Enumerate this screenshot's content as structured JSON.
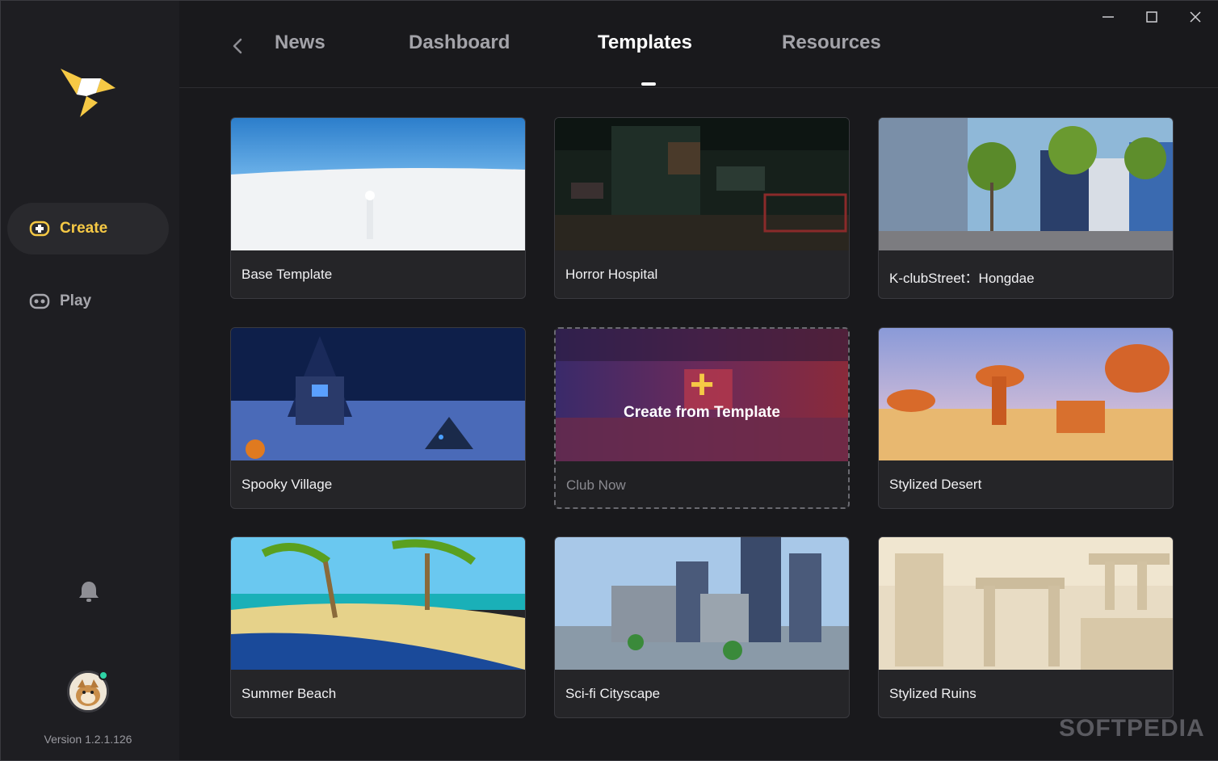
{
  "sidebar": {
    "nav": [
      {
        "label": "Create",
        "icon": "gamepad-plus-icon",
        "active": true
      },
      {
        "label": "Play",
        "icon": "gamepad-icon",
        "active": false
      }
    ],
    "version": "Version 1.2.1.126"
  },
  "header": {
    "tabs": [
      {
        "label": "News"
      },
      {
        "label": "Dashboard"
      },
      {
        "label": "Templates",
        "active": true
      },
      {
        "label": "Resources"
      }
    ]
  },
  "templates": [
    {
      "name": "Base Template"
    },
    {
      "name": "Horror Hospital"
    },
    {
      "name": "K-clubStreet：Hongdae"
    },
    {
      "name": "Spooky Village"
    },
    {
      "name": "Club Now",
      "hover_action": "Create from Template"
    },
    {
      "name": "Stylized Desert"
    },
    {
      "name": "Summer Beach"
    },
    {
      "name": "Sci-fi Cityscape"
    },
    {
      "name": "Stylized Ruins"
    }
  ],
  "colors": {
    "accent": "#f6c945",
    "background": "#19191c",
    "sidebar": "#1e1e22",
    "online": "#2ed3a5"
  },
  "watermark": "SOFTPEDIA"
}
